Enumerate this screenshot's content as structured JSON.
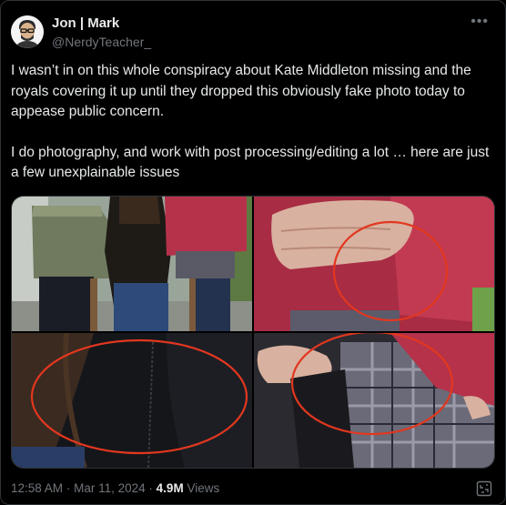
{
  "author": {
    "name": "Jon | Mark",
    "handle": "@NerdyTeacher_"
  },
  "more_icon": "more-horizontal-icon",
  "tweet": {
    "paragraph1": "I wasn’t in on this whole conspiracy about Kate Middleton missing and the royals covering it up until they dropped this obviously fake photo today to appease public concern.",
    "paragraph2": "I do photography, and work with post processing/editing a lot … here are just a few unexplainable issues"
  },
  "footer": {
    "time": "12:58 AM",
    "separator": "·",
    "date": "Mar 11, 2024",
    "views_count": "4.9M",
    "views_label": "Views"
  },
  "colors": {
    "background": "#000000",
    "text": "#e7e9ea",
    "secondary_text": "#71767b",
    "border": "#2f3336",
    "annotation_red": "#e2371f",
    "cardigan_red": "#b5324a"
  }
}
